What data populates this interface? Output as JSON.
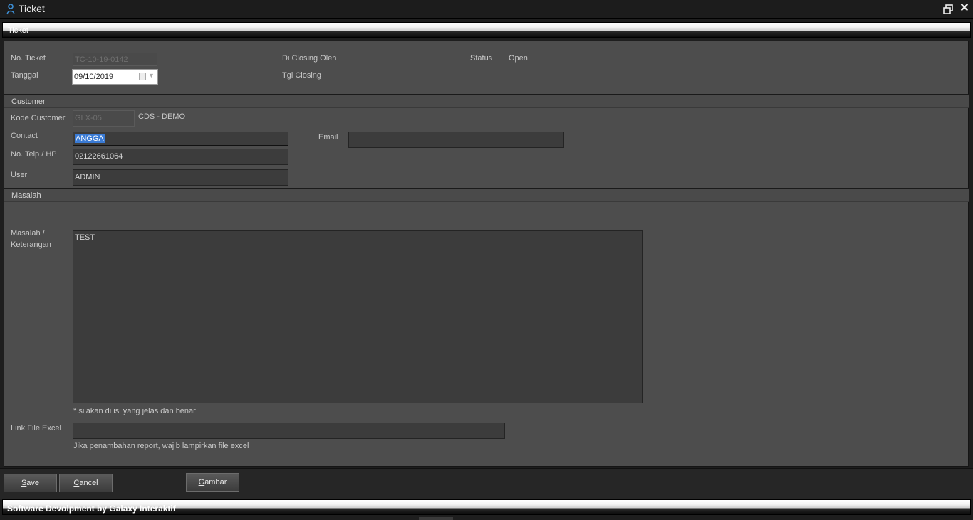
{
  "window": {
    "title": "Ticket"
  },
  "header_bar": {
    "label": "Ticket"
  },
  "ticket": {
    "no_ticket_label": "No. Ticket",
    "no_ticket_value": "TC-10-19-0142",
    "tanggal_label": "Tanggal",
    "tanggal_value": "09/10/2019",
    "closing_by_label": "Di Closing Oleh",
    "closing_date_label": "Tgl Closing",
    "status_label": "Status",
    "status_value": "Open"
  },
  "customer": {
    "section_title": "Customer",
    "kode_label": "Kode Customer",
    "kode_value": "GLX-05",
    "customer_name": "CDS - DEMO",
    "contact_label": "Contact",
    "contact_value": "ANGGA",
    "email_label": "Email",
    "email_value": "",
    "telp_label": "No. Telp / HP",
    "telp_value": "02122661064",
    "user_label": "User",
    "user_value": "ADMIN"
  },
  "masalah": {
    "section_title": "Masalah",
    "label_line1": "Masalah /",
    "label_line2": "Keterangan",
    "value": "TEST",
    "hint": "* silakan di isi yang jelas dan benar",
    "link_label": "Link File Excel",
    "link_value": "",
    "link_hint": "Jika penambahan report, wajib lampirkan file excel"
  },
  "buttons": {
    "save_mnemonic": "S",
    "save_rest": "ave",
    "cancel_mnemonic": "C",
    "cancel_rest": "ancel",
    "gambar_mnemonic": "G",
    "gambar_rest": "ambar"
  },
  "footer": {
    "label": "Software Devolpment by Galaxy Interaktif"
  },
  "colors": {
    "background": "#4d4d4d",
    "selection": "#3a7bd5",
    "accent_icon": "#3d8fd6"
  },
  "icons": [
    "app-user-icon",
    "restore-window-icon",
    "close-icon",
    "calendar-icon",
    "dropdown-arrow-icon"
  ]
}
